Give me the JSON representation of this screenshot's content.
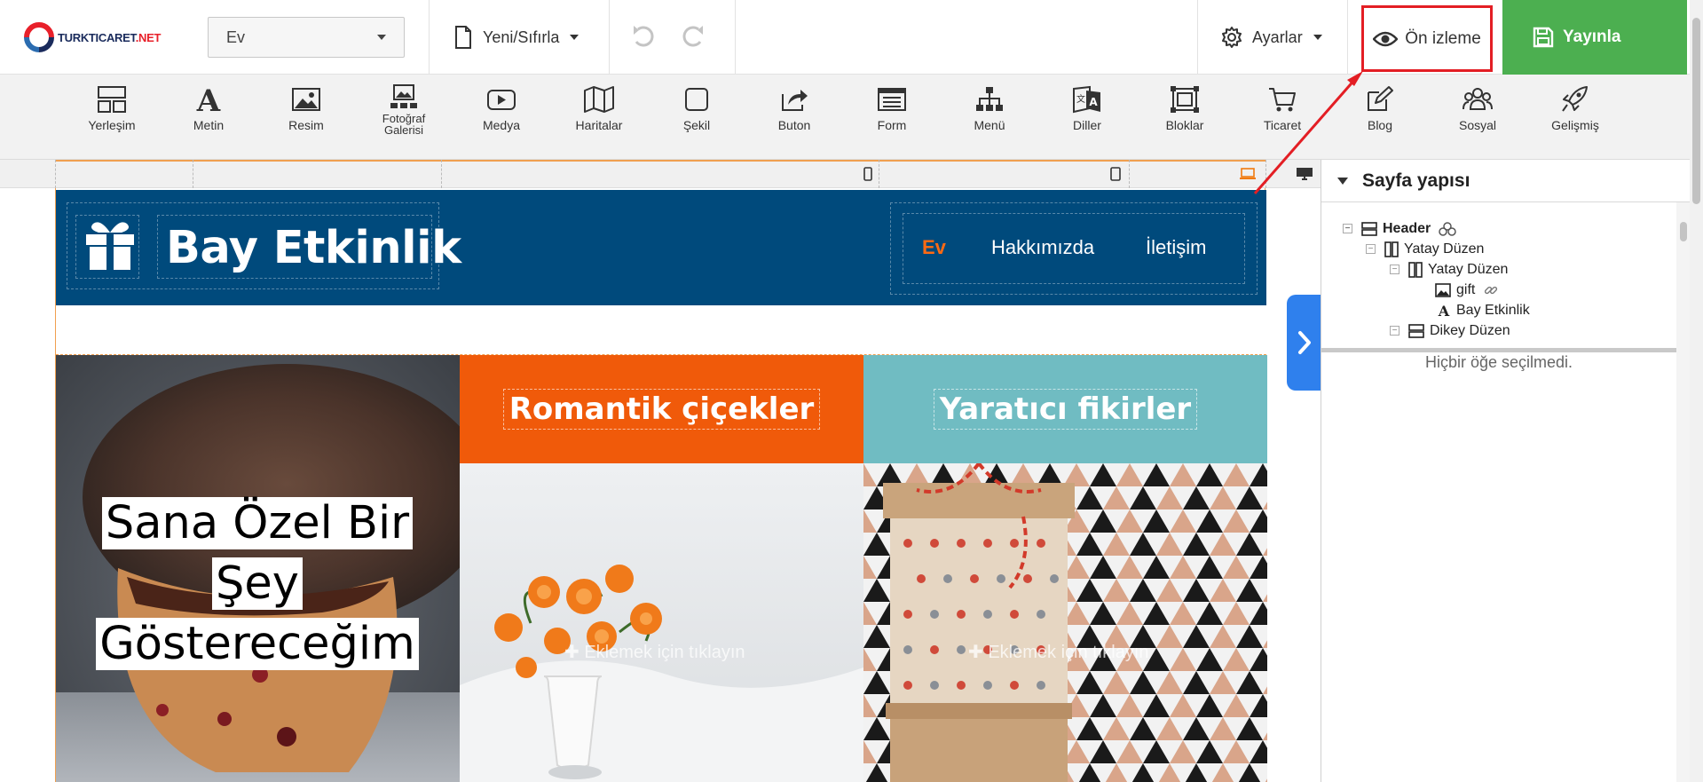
{
  "brand": {
    "logo_main": "TURKTICARET",
    "logo_net": ".NET"
  },
  "toolbar": {
    "page_select_value": "Ev",
    "new_reset_label": "Yeni/Sıfırla",
    "settings_label": "Ayarlar",
    "preview_label": "Ön izleme",
    "publish_label": "Yayınla"
  },
  "elements": [
    {
      "name": "layout",
      "label": "Yerleşim",
      "icon": "layout-icon"
    },
    {
      "name": "text",
      "label": "Metin",
      "icon": "text-icon"
    },
    {
      "name": "image",
      "label": "Resim",
      "icon": "image-icon"
    },
    {
      "name": "gallery",
      "label": "Fotoğraf Galerisi",
      "icon": "gallery-icon"
    },
    {
      "name": "media",
      "label": "Medya",
      "icon": "video-icon"
    },
    {
      "name": "maps",
      "label": "Haritalar",
      "icon": "map-icon"
    },
    {
      "name": "shape",
      "label": "Şekil",
      "icon": "square-icon"
    },
    {
      "name": "button",
      "label": "Buton",
      "icon": "share-icon"
    },
    {
      "name": "form",
      "label": "Form",
      "icon": "form-icon"
    },
    {
      "name": "menu",
      "label": "Menü",
      "icon": "sitemap-icon"
    },
    {
      "name": "languages",
      "label": "Diller",
      "icon": "translate-icon"
    },
    {
      "name": "blocks",
      "label": "Bloklar",
      "icon": "blocks-icon"
    },
    {
      "name": "commerce",
      "label": "Ticaret",
      "icon": "cart-icon"
    },
    {
      "name": "blog",
      "label": "Blog",
      "icon": "edit-icon"
    },
    {
      "name": "social",
      "label": "Sosyal",
      "icon": "users-icon"
    },
    {
      "name": "advanced",
      "label": "Gelişmiş",
      "icon": "rocket-icon"
    }
  ],
  "site": {
    "title": "Bay Etkinlik",
    "nav": [
      "Ev",
      "Hakkımızda",
      "İletişim"
    ],
    "hero_lines": [
      "Sana Özel Bir",
      "Şey",
      "Göstereceğim"
    ],
    "col2_title": "Romantik çiçekler",
    "col3_title": "Yaratıcı fikirler",
    "click_hint": "Eklemek için tıklayın",
    "colors": {
      "header": "#004a7c",
      "orange": "#f05a0a",
      "teal": "#70bcc2",
      "publish": "#4caf50",
      "highlight": "#e31e24"
    }
  },
  "panel": {
    "title": "Sayfa yapısı",
    "tree": [
      {
        "label": "Header",
        "icon": "rows-icon",
        "bold": true,
        "extra": "group-icon"
      },
      {
        "label": "Yatay Düzen",
        "icon": "columns-icon"
      },
      {
        "label": "Yatay Düzen",
        "icon": "columns-icon"
      },
      {
        "label": "gift",
        "icon": "image-icon",
        "extra": "link-icon"
      },
      {
        "label": "Bay Etkinlik",
        "icon": "text-icon"
      },
      {
        "label": "Dikey Düzen",
        "icon": "rows-icon"
      }
    ],
    "no_selection": "Hiçbir öğe seçilmedi."
  }
}
